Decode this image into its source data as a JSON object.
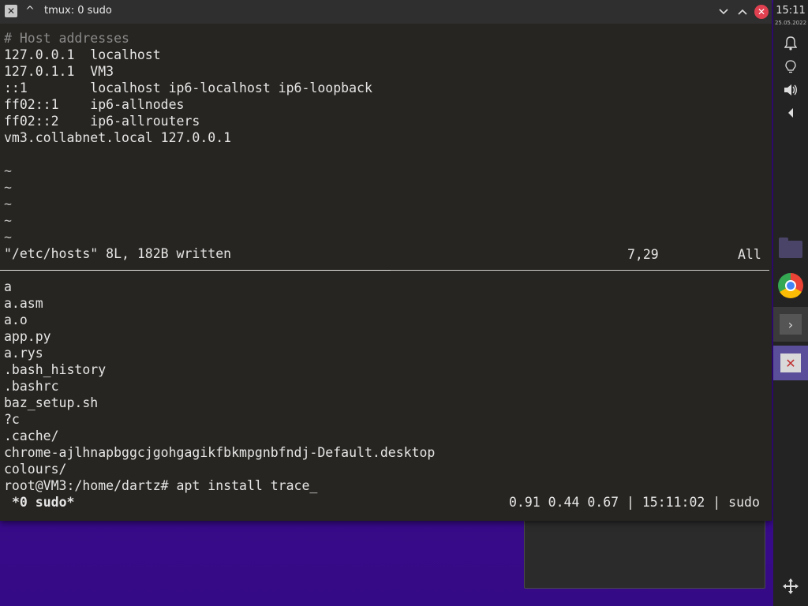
{
  "window": {
    "title": "tmux: 0 sudo",
    "app_icon": "terminal-app-icon",
    "keep_icon": "keep-above-icon",
    "min_icon": "chevron-down-icon",
    "max_icon": "chevron-up-icon",
    "close_icon": "close-icon"
  },
  "vim": {
    "lines": [
      "# Host addresses",
      "127.0.0.1  localhost",
      "127.0.1.1  VM3",
      "::1        localhost ip6-localhost ip6-loopback",
      "ff02::1    ip6-allnodes",
      "ff02::2    ip6-allrouters",
      "vm3.collabnet.local 127.0.0.1",
      "",
      "~",
      "~",
      "~",
      "~",
      "~"
    ],
    "status_message": "\"/etc/hosts\" 8L, 182B written",
    "cursor_position": "7,29",
    "scroll_position": "All"
  },
  "shell": {
    "lines": [
      "a",
      "a.asm",
      "a.o",
      "app.py",
      "a.rys",
      ".bash_history",
      ".bashrc",
      "baz_setup.sh",
      "?c",
      ".cache/",
      "chrome-ajlhnapbggcjgohgagikfbkmpgnbfndj-Default.desktop",
      "colours/",
      "root@VM3:/home/dartz# apt install trace_"
    ]
  },
  "tmux_status": {
    "window_label": "*0 sudo*",
    "info": "0.91 0.44 0.67 | 15:11:02 | sudo"
  },
  "panel": {
    "time": "15:11",
    "date": "25.05.2022",
    "icons": [
      "bell-icon",
      "lightbulb-icon",
      "volume-icon",
      "arrow-left-icon",
      "folder-icon",
      "chrome-icon",
      "terminal-icon",
      "close-window-icon",
      "move-icon"
    ]
  }
}
